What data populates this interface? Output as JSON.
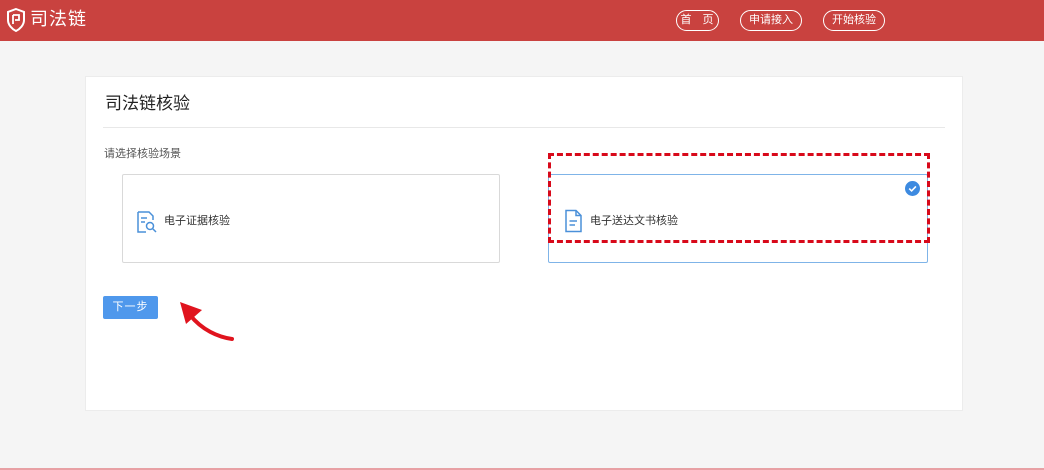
{
  "header": {
    "logo_text": "司法链",
    "nav": [
      {
        "label": "首 页"
      },
      {
        "label": "申请接入"
      },
      {
        "label": "开始核验"
      }
    ]
  },
  "main": {
    "title": "司法链核验",
    "select_label": "请选择核验场景",
    "options": [
      {
        "label": "电子证据核验",
        "icon": "document-search-icon",
        "selected": false
      },
      {
        "label": "电子送达文书核验",
        "icon": "document-icon",
        "selected": true
      }
    ],
    "next_label": "下一步"
  },
  "annotations": {
    "highlight_color": "#d8091a",
    "arrow_color": "#e0141e"
  },
  "colors": {
    "header_bg": "#c9423f",
    "primary": "#4f98ec",
    "selected_border": "#7fb4e8"
  }
}
